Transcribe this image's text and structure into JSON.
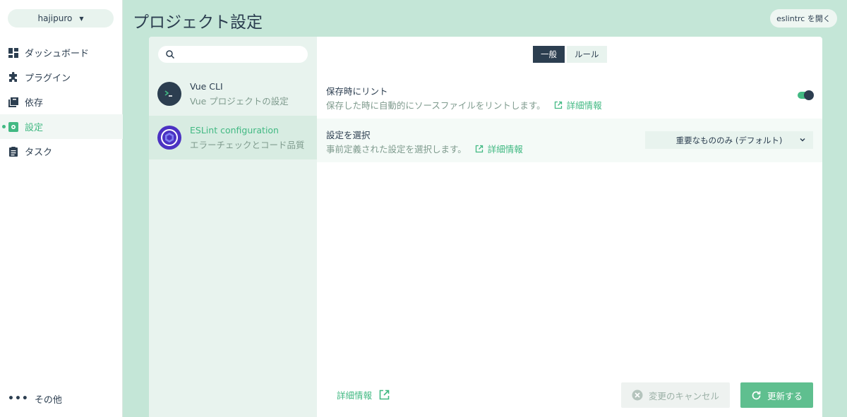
{
  "sidebar": {
    "project": "hajipuro",
    "items": [
      {
        "label": "ダッシュボード",
        "icon": "dashboard-icon",
        "active": false
      },
      {
        "label": "プラグイン",
        "icon": "puzzle-icon",
        "active": false
      },
      {
        "label": "依存",
        "icon": "library-icon",
        "active": false
      },
      {
        "label": "設定",
        "icon": "settings-icon",
        "active": true
      },
      {
        "label": "タスク",
        "icon": "clipboard-icon",
        "active": false
      }
    ],
    "more": "その他"
  },
  "header": {
    "title": "プロジェクト設定",
    "open_button": "eslintrc を開く"
  },
  "configs": {
    "search_placeholder": "",
    "items": [
      {
        "name": "Vue CLI",
        "desc": "Vue プロジェクトの設定",
        "icon": "terminal-icon",
        "active": false
      },
      {
        "name": "ESLint configuration",
        "desc": "エラーチェックとコード品質",
        "icon": "eslint-icon",
        "active": true
      }
    ]
  },
  "tabs": [
    {
      "label": "一般",
      "active": true
    },
    {
      "label": "ルール",
      "active": false
    }
  ],
  "prompts": [
    {
      "label": "保存時にリント",
      "desc": "保存した時に自動的にソースファイルをリントします。",
      "link": "詳細情報",
      "control": "toggle",
      "value": true
    },
    {
      "label": "設定を選択",
      "desc": "事前定義された設定を選択します。",
      "link": "詳細情報",
      "control": "select",
      "value": "重要なもののみ (デフォルト)"
    }
  ],
  "footer": {
    "more_info": "詳細情報",
    "cancel": "変更のキャンセル",
    "refresh": "更新する"
  },
  "colors": {
    "accent": "#42b983",
    "dark": "#2c3e50",
    "background": "#c4e6d7"
  }
}
